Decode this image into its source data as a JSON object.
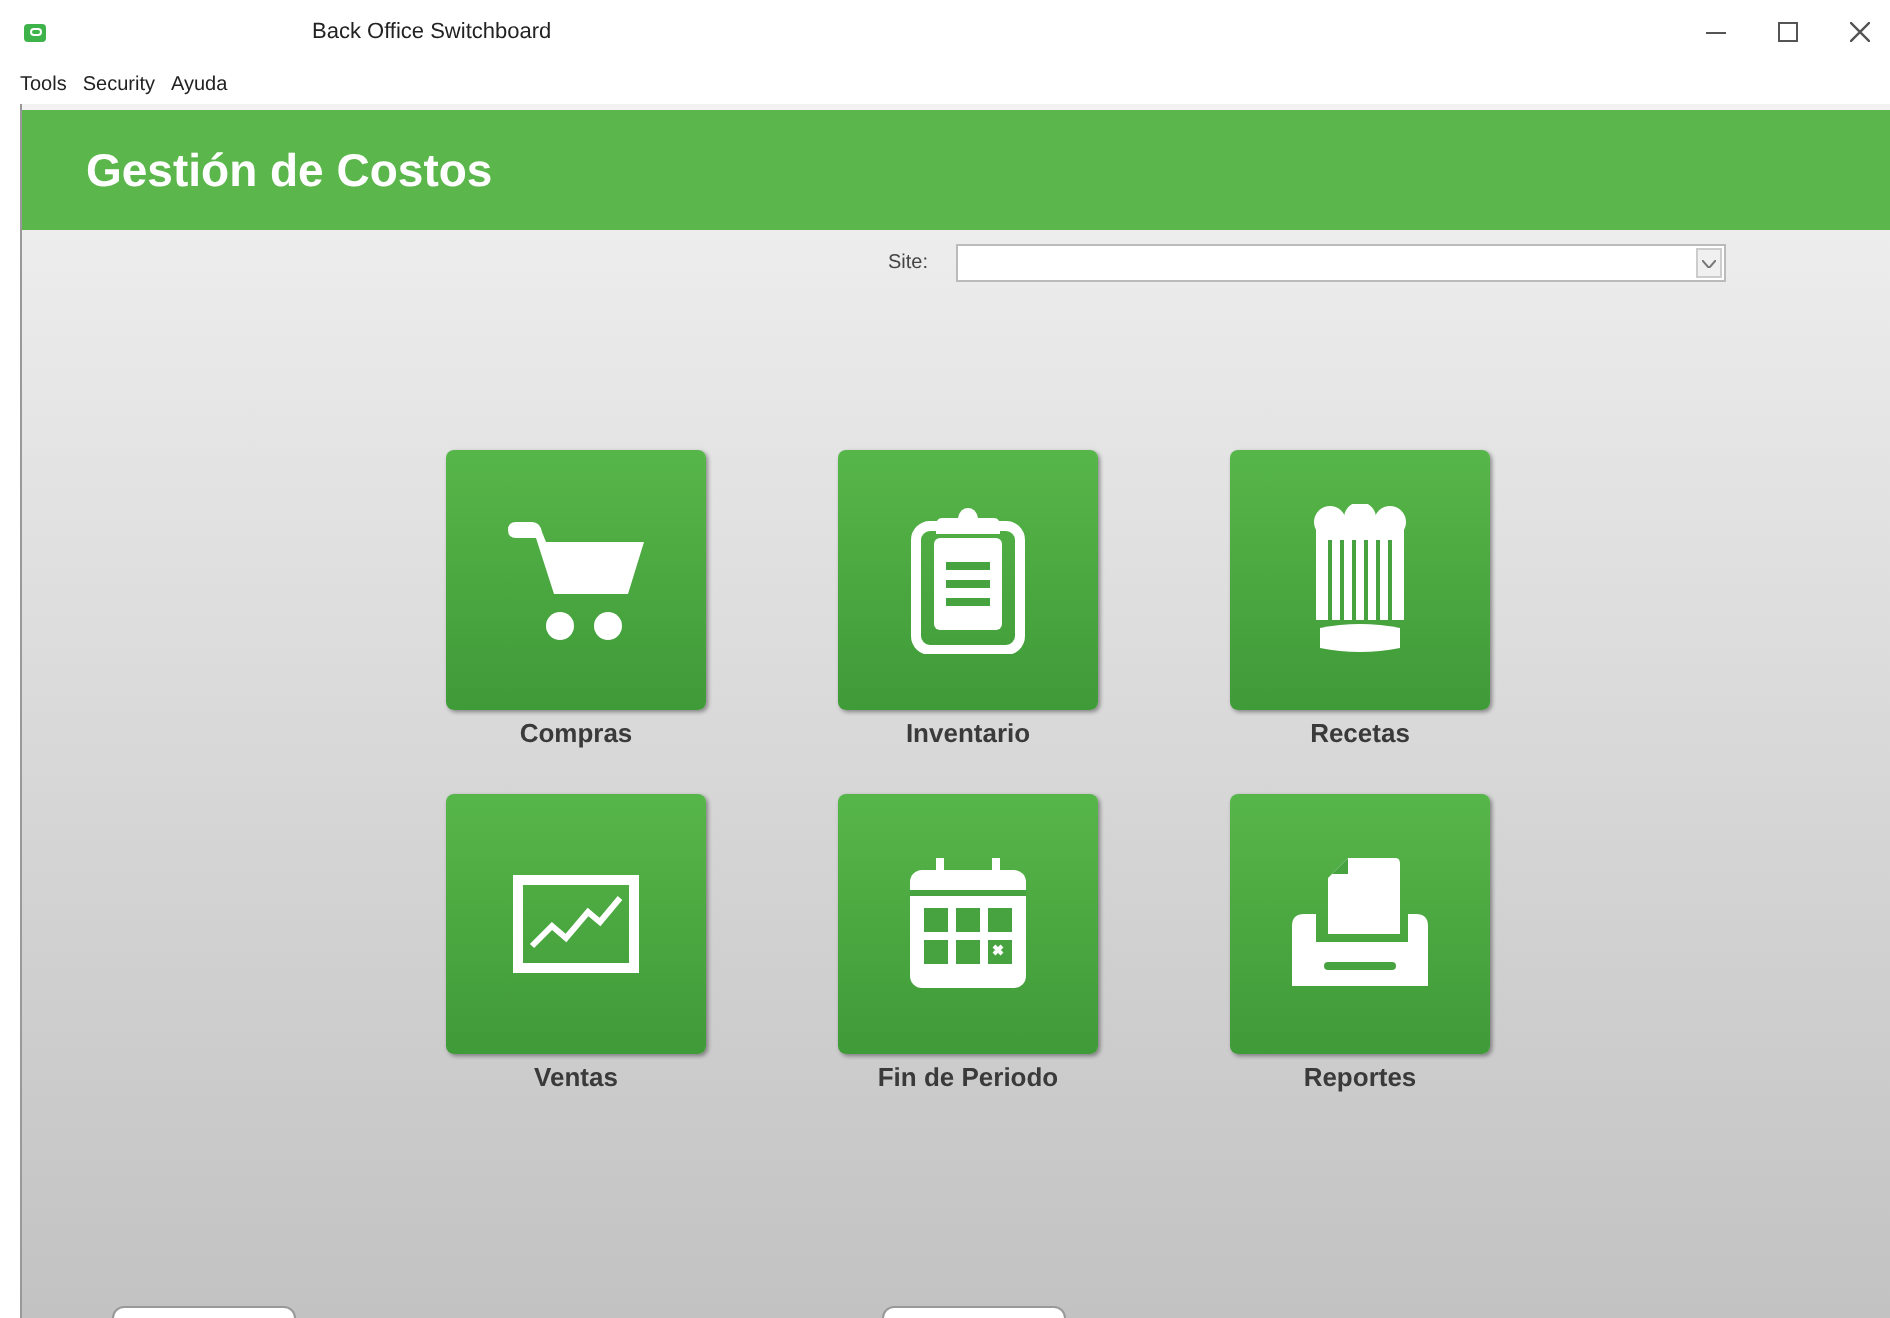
{
  "window": {
    "title": "Back Office Switchboard"
  },
  "menu": [
    "Tools",
    "Security",
    "Ayuda"
  ],
  "header": {
    "title": "Gestión de Costos"
  },
  "site": {
    "label": "Site:"
  },
  "tiles": [
    {
      "label": "Compras",
      "kind": "cart"
    },
    {
      "label": "Inventario",
      "kind": "clipboard"
    },
    {
      "label": "Recetas",
      "kind": "hat"
    },
    {
      "label": "Ventas",
      "kind": "chart"
    },
    {
      "label": "Fin de Periodo",
      "kind": "calendar"
    },
    {
      "label": "Reportes",
      "kind": "tray"
    }
  ]
}
